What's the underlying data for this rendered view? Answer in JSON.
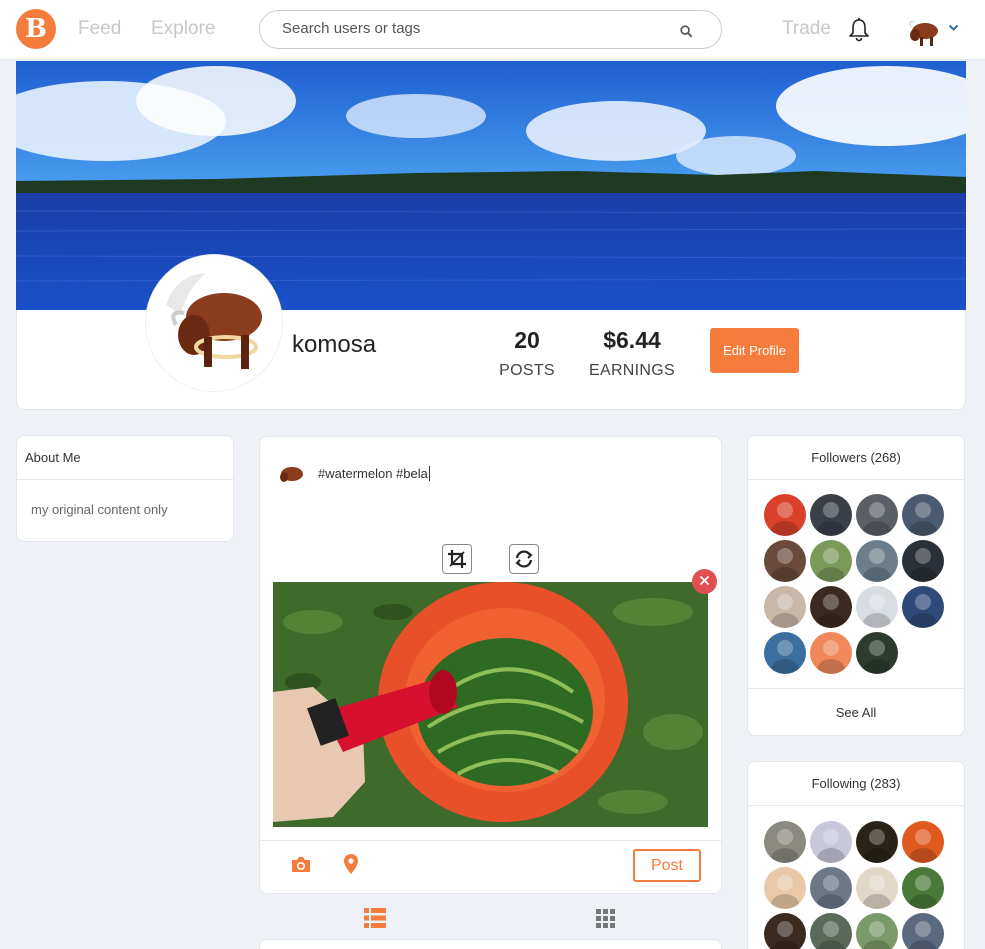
{
  "nav": {
    "feed": "Feed",
    "explore": "Explore",
    "search_placeholder": "Search users or tags",
    "trade": "Trade"
  },
  "profile": {
    "username": "komosa",
    "posts_count": "20",
    "posts_label": "POSTS",
    "earnings": "$6.44",
    "earnings_label": "EARNINGS",
    "edit_label": "Edit Profile"
  },
  "about": {
    "title": "About Me",
    "text": "my original content only"
  },
  "composer": {
    "text": "#watermelon #bela",
    "post_label": "Post"
  },
  "followers": {
    "title": "Followers (268)",
    "see_all": "See All",
    "avatar_colors": [
      "#d9412b",
      "#3a3f48",
      "#5b5f66",
      "#4a5a70",
      "#6a4a3a",
      "#7a9a5a",
      "#6b7e8a",
      "#2b3138",
      "#c9b8a8",
      "#3a2a22",
      "#d8dde2",
      "#2f4a78",
      "#3a6fa0",
      "#f0885c",
      "#2d3b2e"
    ]
  },
  "following": {
    "title": "Following (283)",
    "avatar_colors": [
      "#8a8a80",
      "#c8c8d8",
      "#2a2418",
      "#e05a20",
      "#e8c8a8",
      "#6a7888",
      "#e2d8c8",
      "#4a7a3a",
      "#3a2a20",
      "#5a6a5a",
      "#7a9a6a",
      "#5a6a80"
    ]
  },
  "colors": {
    "accent": "#f47c3c",
    "danger": "#e05050"
  }
}
